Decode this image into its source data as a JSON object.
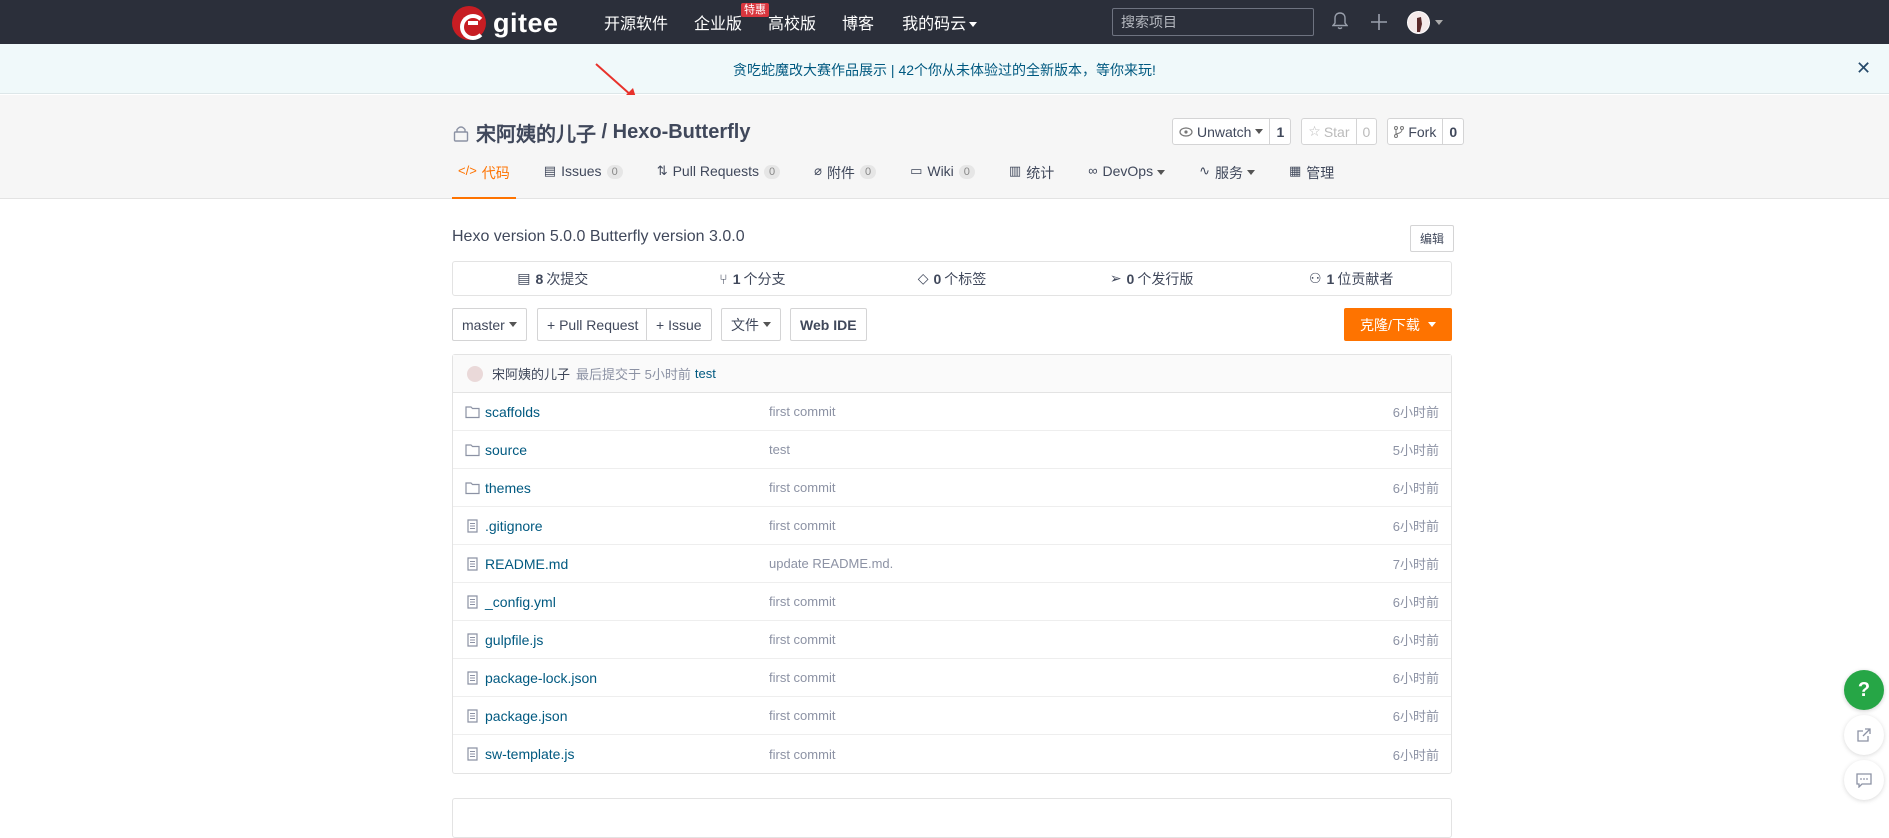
{
  "topnav": {
    "logo_text": "gitee",
    "links": [
      "开源软件",
      "企业版",
      "高校版",
      "博客",
      "我的码云"
    ],
    "hot_badge": "特惠",
    "search_placeholder": "搜索项目"
  },
  "banner": {
    "text": "贪吃蛇魔改大赛作品展示 | 42个你从未体验过的全新版本，等你来玩!",
    "close": "✕"
  },
  "repo": {
    "owner": "宋阿姨的儿子",
    "sep": " / ",
    "name": "Hexo-Butterfly",
    "unwatch_label": "Unwatch",
    "unwatch_count": "1",
    "star_label": "Star",
    "star_count": "0",
    "fork_label": "Fork",
    "fork_count": "0"
  },
  "tabs": [
    {
      "label": "代码",
      "icon": "</>"
    },
    {
      "label": "Issues",
      "count": "0"
    },
    {
      "label": "Pull Requests",
      "count": "0"
    },
    {
      "label": "附件",
      "count": "0"
    },
    {
      "label": "Wiki",
      "count": "0"
    },
    {
      "label": "统计"
    },
    {
      "label": "DevOps"
    },
    {
      "label": "服务"
    },
    {
      "label": "管理"
    }
  ],
  "description": "Hexo version 5.0.0 Butterfly version 3.0.0",
  "edit_label": "编辑",
  "stats": [
    {
      "num": "8",
      "label": "次提交"
    },
    {
      "num": "1",
      "label": "个分支"
    },
    {
      "num": "0",
      "label": "个标签"
    },
    {
      "num": "0",
      "label": "个发行版"
    },
    {
      "num": "1",
      "label": "位贡献者"
    }
  ],
  "toolbar": {
    "branch": "master",
    "pull_request": "+ Pull Request",
    "issue": "+ Issue",
    "file": "文件",
    "web_ide": "Web IDE",
    "clone": "克隆/下载"
  },
  "last_commit": {
    "author": "宋阿姨的儿子",
    "meta": "最后提交于 5小时前",
    "message": "test"
  },
  "files": [
    {
      "name": "scaffolds",
      "type": "folder",
      "msg": "first commit",
      "time": "6小时前"
    },
    {
      "name": "source",
      "type": "folder",
      "msg": "test",
      "time": "5小时前"
    },
    {
      "name": "themes",
      "type": "folder",
      "msg": "first commit",
      "time": "6小时前"
    },
    {
      "name": ".gitignore",
      "type": "file",
      "msg": "first commit",
      "time": "6小时前"
    },
    {
      "name": "README.md",
      "type": "file",
      "msg": "update README.md.",
      "time": "7小时前"
    },
    {
      "name": "_config.yml",
      "type": "file",
      "msg": "first commit",
      "time": "6小时前"
    },
    {
      "name": "gulpfile.js",
      "type": "file",
      "msg": "first commit",
      "time": "6小时前"
    },
    {
      "name": "package-lock.json",
      "type": "file",
      "msg": "first commit",
      "time": "6小时前"
    },
    {
      "name": "package.json",
      "type": "file",
      "msg": "first commit",
      "time": "6小时前"
    },
    {
      "name": "sw-template.js",
      "type": "file",
      "msg": "first commit",
      "time": "6小时前"
    }
  ],
  "floating": {
    "help": "?"
  },
  "colors": {
    "accent": "#fe7300",
    "nav_bg": "#2b2f3a",
    "link": "#005980",
    "help_green": "#26a646"
  }
}
